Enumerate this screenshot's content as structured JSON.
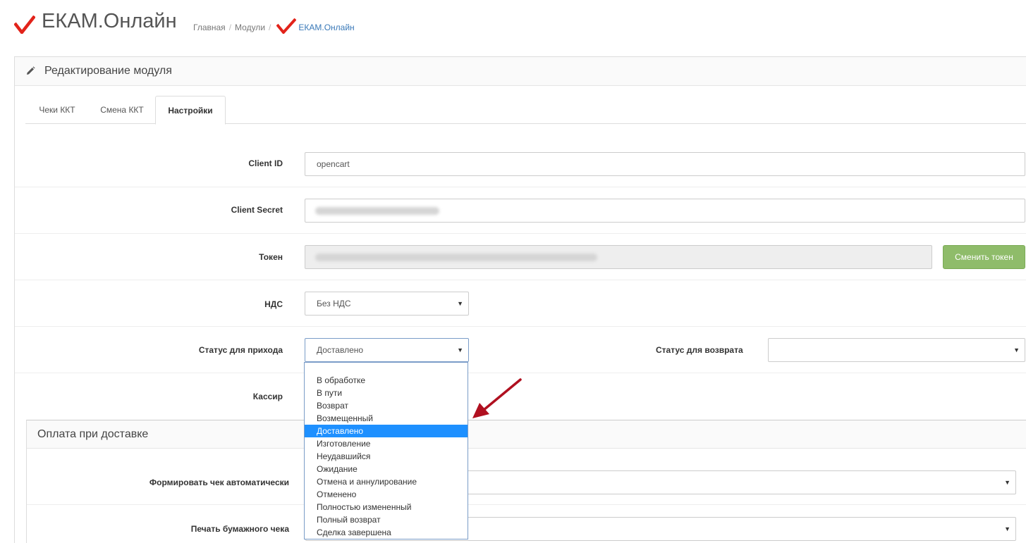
{
  "header": {
    "app_title": "ЕКАМ.Онлайн",
    "breadcrumb": {
      "home": "Главная",
      "modules": "Модули",
      "current": "ЕКАМ.Онлайн",
      "separator": "/"
    },
    "logo_icon": "red-check-icon",
    "brand_color": "#e2231a"
  },
  "panel": {
    "title": "Редактирование модуля",
    "icon": "pencil-icon"
  },
  "tabs": [
    {
      "label": "Чеки ККТ",
      "active": false
    },
    {
      "label": "Смена ККТ",
      "active": false
    },
    {
      "label": "Настройки",
      "active": true
    }
  ],
  "form": {
    "client_id": {
      "label": "Client ID",
      "value": "opencart"
    },
    "client_secret": {
      "label": "Client Secret"
    },
    "token": {
      "label": "Токен",
      "button_label": "Сменить токен",
      "button_color": "#8fbc6a"
    },
    "vat": {
      "label": "НДС",
      "value": "Без НДС"
    },
    "income_status": {
      "label": "Статус для прихода",
      "value": "Доставлено",
      "options": [
        "В обработке",
        "В пути",
        "Возврат",
        "Возмещенный",
        "Доставлено",
        "Изготовление",
        "Неудавшийся",
        "Ожидание",
        "Отмена и аннулирование",
        "Отменено",
        "Полностью измененный",
        "Полный возврат",
        "Сделка завершена"
      ],
      "selected_index": 4,
      "highlight_color": "#1e90ff"
    },
    "refund_status": {
      "label": "Статус для возврата",
      "value": ""
    },
    "cashier": {
      "label": "Кассир"
    }
  },
  "cod_section": {
    "title": "Оплата при доставке",
    "auto_receipt": {
      "label": "Формировать чек автоматически"
    },
    "paper_receipt": {
      "label": "Печать бумажного чека"
    }
  },
  "annotation": {
    "arrow_color": "#b01020"
  }
}
